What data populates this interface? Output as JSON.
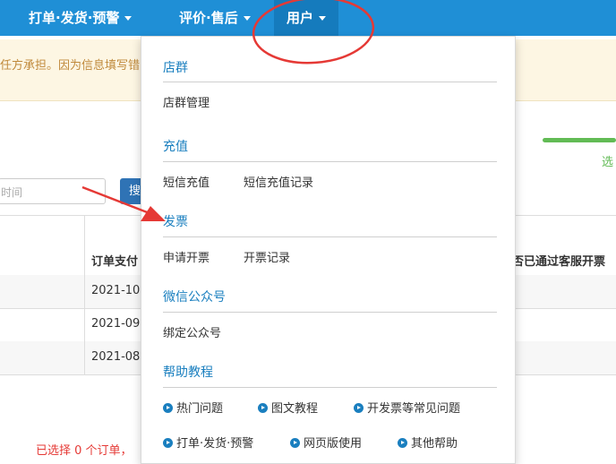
{
  "nav": {
    "item1": "打单·发货·预警",
    "item2": "评价·售后",
    "item3": "用户"
  },
  "notice": {
    "text": "任方承担。因为信息填写错"
  },
  "toolbar": {
    "search_placeholder": "时间",
    "search_button": "搜",
    "select_label": "选"
  },
  "table": {
    "header_pay": "订单支付",
    "header_kf": "否已通过客服开票",
    "rows": [
      "2021-10",
      "2021-09",
      "2021-08"
    ]
  },
  "footer": {
    "selected": "已选择 0 个订单，"
  },
  "dropdown": {
    "sections": [
      {
        "title": "店群",
        "links": [
          "店群管理"
        ]
      },
      {
        "title": "充值",
        "links": [
          "短信充值",
          "短信充值记录"
        ]
      },
      {
        "title": "发票",
        "links": [
          "申请开票",
          "开票记录"
        ]
      },
      {
        "title": "微信公众号",
        "links": [
          "绑定公众号"
        ]
      },
      {
        "title": "帮助教程",
        "links": [
          "热门问题",
          "图文教程",
          "开发票等常见问题",
          "打单·发货·预警",
          "网页版使用",
          "其他帮助"
        ]
      }
    ]
  },
  "colors": {
    "nav": "#1f8fd6",
    "accent": "#1a7fbf",
    "annotation": "#e53935",
    "progress": "#62bb55"
  }
}
